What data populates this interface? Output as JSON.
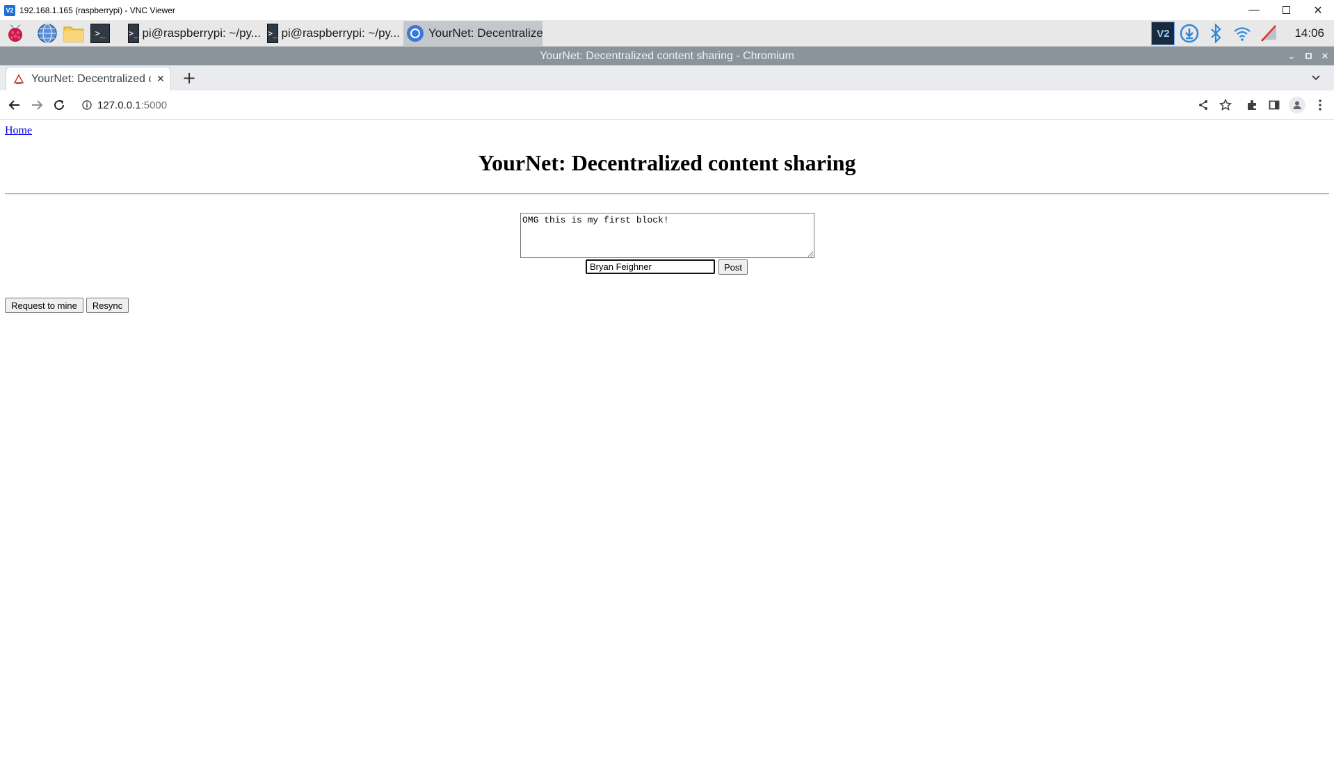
{
  "vnc": {
    "title": "192.168.1.165 (raspberrypi) - VNC Viewer",
    "app_icon_text": "V2"
  },
  "taskbar": {
    "tasks": [
      {
        "label": "pi@raspberrypi: ~/py...",
        "icon": "terminal-icon"
      },
      {
        "label": "pi@raspberrypi: ~/py...",
        "icon": "terminal-icon"
      },
      {
        "label": "YourNet: Decentralize...",
        "icon": "chromium-icon"
      }
    ],
    "clock": "14:06",
    "colors": {
      "accent": "#1a6fd6",
      "active_task": "#c4c8cc"
    }
  },
  "browser": {
    "window_title": "YourNet: Decentralized content sharing - Chromium",
    "tab_title": "YourNet: Decentralized content sharing",
    "url_host": "127.0.0.1",
    "url_port": ":5000"
  },
  "page": {
    "home_link": "Home",
    "heading": "YourNet: Decentralized content sharing",
    "textarea_value": "OMG this is my first block!",
    "name_value": "Bryan Feighner",
    "post_button": "Post",
    "mine_button": "Request to mine",
    "resync_button": "Resync"
  }
}
